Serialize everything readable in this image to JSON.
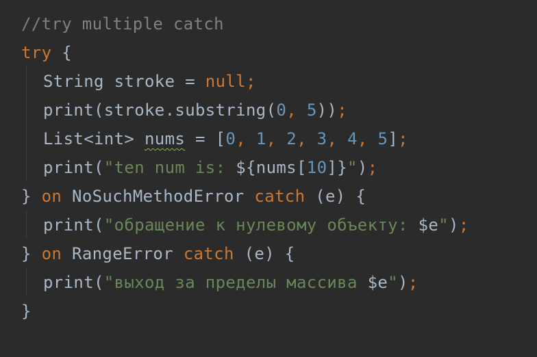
{
  "code": {
    "l1": {
      "comment": "//try multiple catch"
    },
    "l2": {
      "kw": "try",
      "rest": " {"
    },
    "l3": {
      "a": "String stroke = ",
      "kw": "null",
      "semi": ";"
    },
    "l4": {
      "a": "print(stroke.substring(",
      "n1": "0",
      "comma": ", ",
      "n2": "5",
      "b": "))",
      "semi": ";"
    },
    "l5": {
      "a": "List<int> ",
      "var": "nums",
      "b": " = [",
      "n0": "0",
      "n1": "1",
      "n2": "2",
      "n3": "3",
      "n4": "4",
      "n5": "5",
      "sep": ", ",
      "c": "]",
      "semi": ";"
    },
    "l6": {
      "a": "print(",
      "s1": "\"ten num is: ",
      "interp_open": "${nums[",
      "n": "10",
      "interp_close": "]}",
      "s2": "\"",
      "b": ")",
      "semi": ";"
    },
    "l7": {
      "a": "} ",
      "kw1": "on",
      "b": " NoSuchMethodError ",
      "kw2": "catch",
      "c": " (e) {"
    },
    "l8": {
      "a": "print(",
      "s1": "\"обращение к нулевому объекту: ",
      "interp": "$e",
      "s2": "\"",
      "b": ")",
      "semi": ";"
    },
    "l9": {
      "a": "} ",
      "kw1": "on",
      "b": " RangeError ",
      "kw2": "catch",
      "c": " (e) {"
    },
    "l10": {
      "a": "print(",
      "s1": "\"выход за пределы массива ",
      "interp": "$e",
      "s2": "\"",
      "b": ")",
      "semi": ";"
    },
    "l11": {
      "a": "}"
    }
  },
  "colors": {
    "background": "#2b2b2b",
    "keyword": "#cc7832",
    "number": "#6897bb",
    "string": "#6a8759",
    "comment": "#808080",
    "plain": "#a9b7c6",
    "warning_underline": "#8fbc2f"
  }
}
